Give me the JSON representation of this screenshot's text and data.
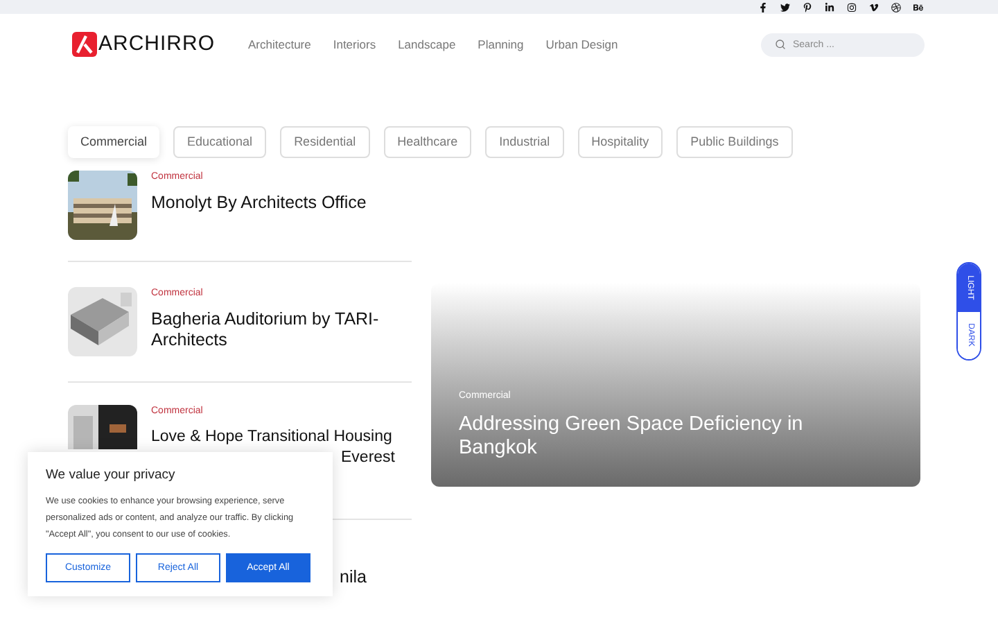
{
  "logo": {
    "text": "ARCHIRRO"
  },
  "nav": [
    {
      "label": "Architecture"
    },
    {
      "label": "Interiors"
    },
    {
      "label": "Landscape"
    },
    {
      "label": "Planning"
    },
    {
      "label": "Urban Design"
    }
  ],
  "search": {
    "placeholder": "Search ..."
  },
  "filters": [
    {
      "label": "Commercial",
      "selected": true
    },
    {
      "label": "Educational",
      "selected": false
    },
    {
      "label": "Residential",
      "selected": false
    },
    {
      "label": "Healthcare",
      "selected": false
    },
    {
      "label": "Industrial",
      "selected": false
    },
    {
      "label": "Hospitality",
      "selected": false
    },
    {
      "label": "Public Buildings",
      "selected": false
    }
  ],
  "articles": [
    {
      "kind": "full",
      "category": "Commercial",
      "title": "Monolyt By Architects Office"
    },
    {
      "kind": "full",
      "category": "Commercial",
      "title": "Bagheria Auditorium by TARI-Architects"
    },
    {
      "kind": "covered",
      "category": "Commercial",
      "title": "Love & Hope Transitional Housing",
      "title_tail": "Everest"
    },
    {
      "kind": "cut",
      "title": "nila"
    }
  ],
  "featured": {
    "category": "Commercial",
    "title": "Addressing Green Space Deficiency in Bangkok"
  },
  "theme_toggle": [
    {
      "label": "LIGHT",
      "selected": true
    },
    {
      "label": "DARK",
      "selected": false
    }
  ],
  "cookie_banner": {
    "title": "We value your privacy",
    "text": "We use cookies to enhance your browsing experience, serve personalized ads or content, and analyze our traffic. By clicking \"Accept All\", you consent to our use of cookies.",
    "buttons": [
      {
        "label": "Customize",
        "kind": "outline"
      },
      {
        "label": "Reject All",
        "kind": "outline"
      },
      {
        "label": "Accept All",
        "kind": "primary"
      }
    ]
  }
}
